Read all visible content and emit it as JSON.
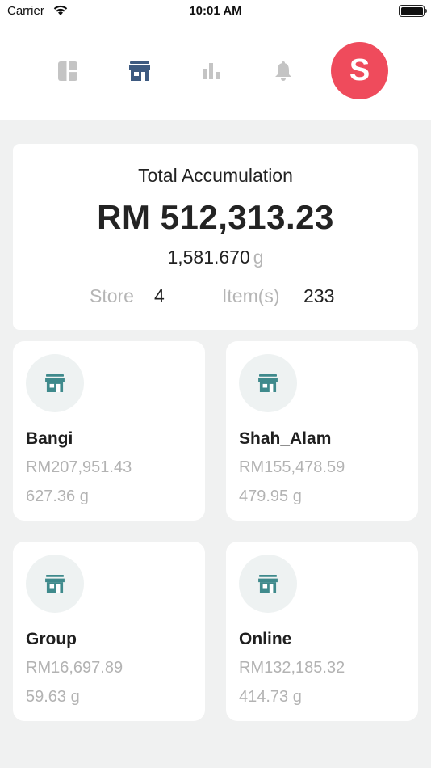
{
  "status_bar": {
    "carrier": "Carrier",
    "time": "10:01 AM"
  },
  "nav": {
    "items": [
      {
        "name": "dashboard",
        "icon": "dashboard-icon",
        "active": false
      },
      {
        "name": "store",
        "icon": "store-icon",
        "active": true
      },
      {
        "name": "reports",
        "icon": "bar-chart-icon",
        "active": false
      },
      {
        "name": "notifications",
        "icon": "bell-icon",
        "active": false
      }
    ],
    "avatar_initial": "S"
  },
  "summary": {
    "title": "Total Accumulation",
    "amount": "RM 512,313.23",
    "weight_value": "1,581.670",
    "weight_unit": "g",
    "store_label": "Store",
    "store_count": "4",
    "items_label": "Item(s)",
    "items_count": "233"
  },
  "stores": [
    {
      "name": "Bangi",
      "amount": "RM207,951.43",
      "weight": "627.36 g"
    },
    {
      "name": "Shah_Alam",
      "amount": "RM155,478.59",
      "weight": "479.95 g"
    },
    {
      "name": "Group",
      "amount": "RM16,697.89",
      "weight": "59.63 g"
    },
    {
      "name": "Online",
      "amount": "RM132,185.32",
      "weight": "414.73 g"
    }
  ],
  "colors": {
    "accent": "#ef4b5c",
    "active_icon": "#3d5a80",
    "inactive_icon": "#c4c4c4",
    "store_icon": "#3f8a8c",
    "background": "#f0f1f1"
  }
}
